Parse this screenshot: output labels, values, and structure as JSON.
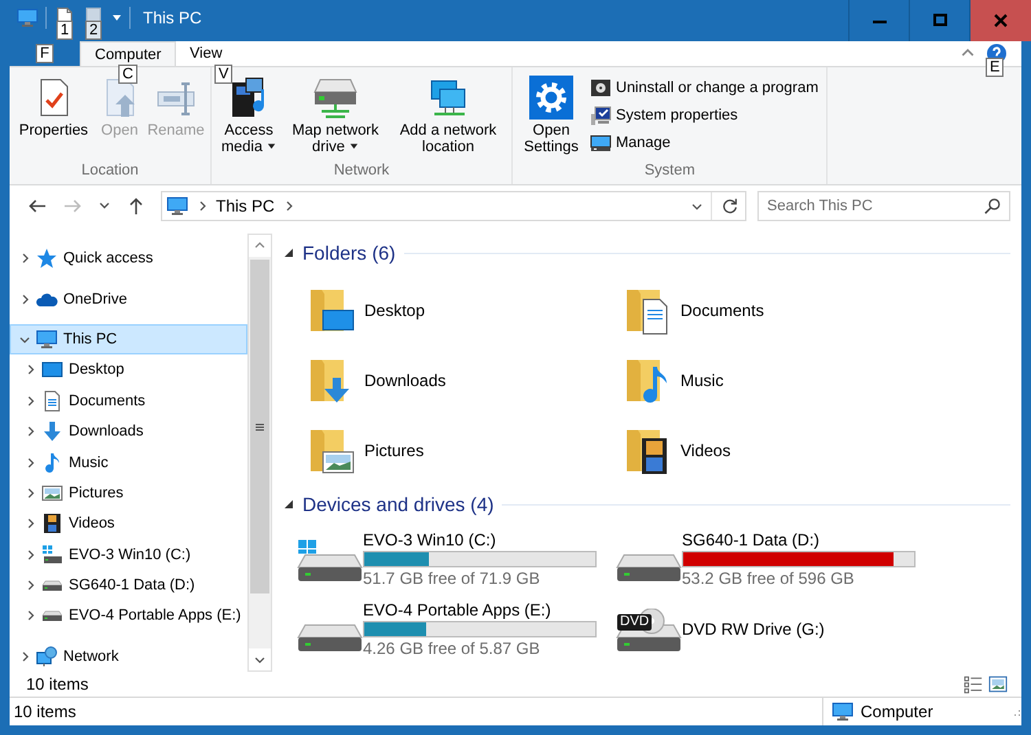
{
  "window": {
    "title": "This PC"
  },
  "quick_access_toolbar": [
    {
      "keytip": "1"
    },
    {
      "keytip": "2"
    }
  ],
  "ribbon_tabs": [
    {
      "kind": "file",
      "keytip": "F",
      "selected": false
    },
    {
      "kind": "tab",
      "label": "Computer",
      "keytip": "C",
      "selected": true
    },
    {
      "kind": "tab",
      "label": "View",
      "keytip": "V",
      "selected": false
    }
  ],
  "help": {
    "keytip": "E"
  },
  "ribbon_groups": [
    {
      "label": "Location",
      "commands": [
        {
          "kind": "large",
          "label": "Properties",
          "disabled": false,
          "dropdown": false
        },
        {
          "kind": "large",
          "label": "Open",
          "disabled": true,
          "dropdown": false
        },
        {
          "kind": "large",
          "label": "Rename",
          "disabled": true,
          "dropdown": false
        }
      ]
    },
    {
      "label": "Network",
      "commands": [
        {
          "kind": "large",
          "label": "Access media",
          "disabled": false,
          "dropdown": true
        },
        {
          "kind": "large",
          "label": "Map network drive",
          "disabled": false,
          "dropdown": true
        },
        {
          "kind": "large",
          "label": "Add a network location",
          "disabled": false,
          "dropdown": false
        }
      ]
    },
    {
      "label": "System",
      "commands": [
        {
          "kind": "large",
          "label": "Open Settings",
          "disabled": false,
          "dropdown": false
        },
        {
          "kind": "small",
          "label": "Uninstall or change a program",
          "disabled": false
        },
        {
          "kind": "small",
          "label": "System properties",
          "disabled": false
        },
        {
          "kind": "small",
          "label": "Manage",
          "disabled": false
        }
      ]
    }
  ],
  "nav_buttons": [
    {
      "kind": "back",
      "disabled": false
    },
    {
      "kind": "forward",
      "disabled": true
    },
    {
      "kind": "recent",
      "disabled": false
    },
    {
      "kind": "up",
      "disabled": false
    }
  ],
  "address": {
    "crumbs": [
      "This PC"
    ]
  },
  "search": {
    "placeholder": "Search This PC"
  },
  "nav_tree": [
    {
      "label": "Quick access",
      "expanded": false,
      "selected": false
    },
    {
      "label": "OneDrive",
      "expanded": false,
      "selected": false
    },
    {
      "label": "This PC",
      "expanded": true,
      "selected": true,
      "children": [
        {
          "label": "Desktop",
          "expanded": false,
          "selected": false
        },
        {
          "label": "Documents",
          "expanded": false,
          "selected": false
        },
        {
          "label": "Downloads",
          "expanded": false,
          "selected": false
        },
        {
          "label": "Music",
          "expanded": false,
          "selected": false
        },
        {
          "label": "Pictures",
          "expanded": false,
          "selected": false
        },
        {
          "label": "Videos",
          "expanded": false,
          "selected": false
        },
        {
          "label": "EVO-3 Win10 (C:)",
          "expanded": false,
          "selected": false
        },
        {
          "label": "SG640-1 Data (D:)",
          "expanded": false,
          "selected": false
        },
        {
          "label": "EVO-4 Portable Apps (E:)",
          "expanded": false,
          "selected": false
        }
      ]
    },
    {
      "label": "Network",
      "expanded": false,
      "selected": false
    }
  ],
  "sections": [
    {
      "kind": "folders",
      "title": "Folders (6)",
      "expanded": true,
      "items": [
        {
          "label": "Desktop"
        },
        {
          "label": "Documents"
        },
        {
          "label": "Downloads"
        },
        {
          "label": "Music"
        },
        {
          "label": "Pictures"
        },
        {
          "label": "Videos"
        }
      ]
    },
    {
      "kind": "drives",
      "title": "Devices and drives (4)",
      "expanded": true,
      "items": [
        {
          "kind": "disk",
          "label": "EVO-3 Win10 (C:)",
          "level": 0.28,
          "color": "#1e8fb0",
          "free": "51.7 GB free of 71.9 GB"
        },
        {
          "kind": "disk",
          "label": "SG640-1 Data (D:)",
          "level": 0.91,
          "color": "#d00000",
          "free": "53.2 GB free of 596 GB"
        },
        {
          "kind": "disk",
          "label": "EVO-4 Portable Apps (E:)",
          "level": 0.27,
          "color": "#1e8fb0",
          "free": "4.26 GB free of 5.87 GB"
        },
        {
          "kind": "optical",
          "label": "DVD RW Drive (G:)",
          "icon_label": "DVD"
        }
      ]
    }
  ],
  "pane_status": {
    "count": "10 items"
  },
  "status_bar": {
    "count": "10 items",
    "location": "Computer"
  }
}
